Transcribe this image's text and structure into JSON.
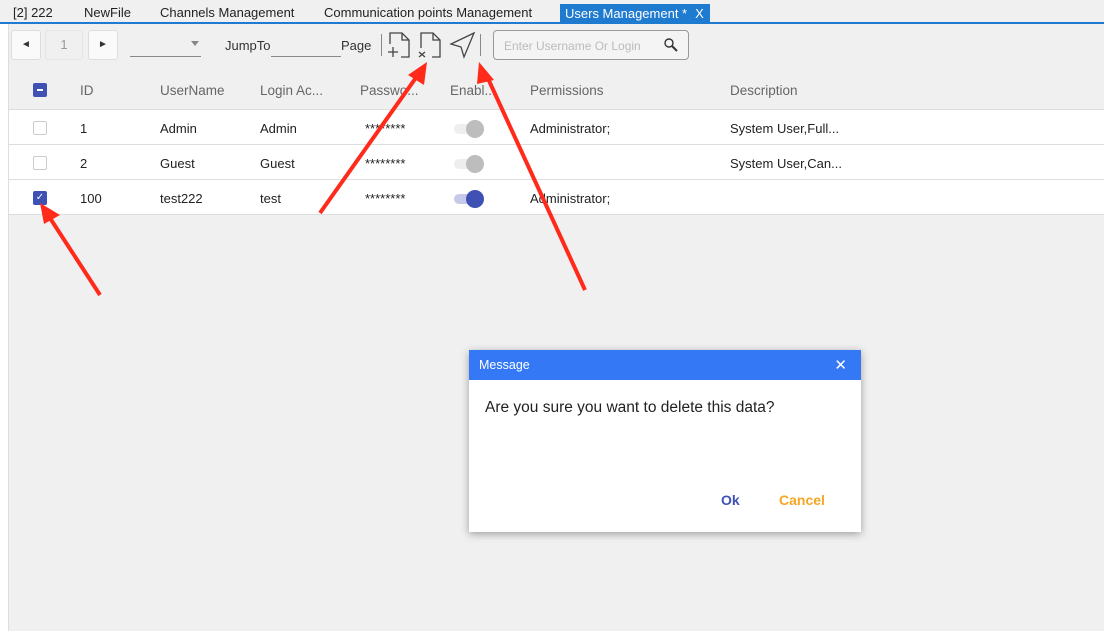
{
  "tabs": [
    {
      "label": "[2] 222"
    },
    {
      "label": "NewFile"
    },
    {
      "label": "Channels Management"
    },
    {
      "label": "Communication points Management"
    },
    {
      "label": "Users Management *",
      "close": "X"
    }
  ],
  "toolbar": {
    "prev": "◄",
    "page": "1",
    "next": "►",
    "jump_label": "JumpTo",
    "page_label": "Page",
    "search_placeholder": "Enter Username Or Login"
  },
  "columns": [
    "ID",
    "UserName",
    "Login Ac...",
    "Passwo...",
    "Enabl...",
    "Permissions",
    "Description"
  ],
  "rows": [
    {
      "id": "1",
      "username": "Admin",
      "login": "Admin",
      "password": "********",
      "enabled": false,
      "checked": false,
      "permissions": "Administrator;",
      "description": "System User,Full..."
    },
    {
      "id": "2",
      "username": "Guest",
      "login": "Guest",
      "password": "********",
      "enabled": false,
      "checked": false,
      "permissions": "",
      "description": "System User,Can..."
    },
    {
      "id": "100",
      "username": "test222",
      "login": "test",
      "password": "********",
      "enabled": true,
      "checked": true,
      "permissions": "Administrator;",
      "description": ""
    }
  ],
  "dialog": {
    "title": "Message",
    "close": "✕",
    "message": "Are you sure you want to delete this data?",
    "ok": "Ok",
    "cancel": "Cancel"
  },
  "colors": {
    "accent": "#3f51b5",
    "tab_active": "#1e7bd0",
    "dialog_header": "#3478f6",
    "cancel": "#f5a623",
    "annotation": "#ff2a1a"
  }
}
